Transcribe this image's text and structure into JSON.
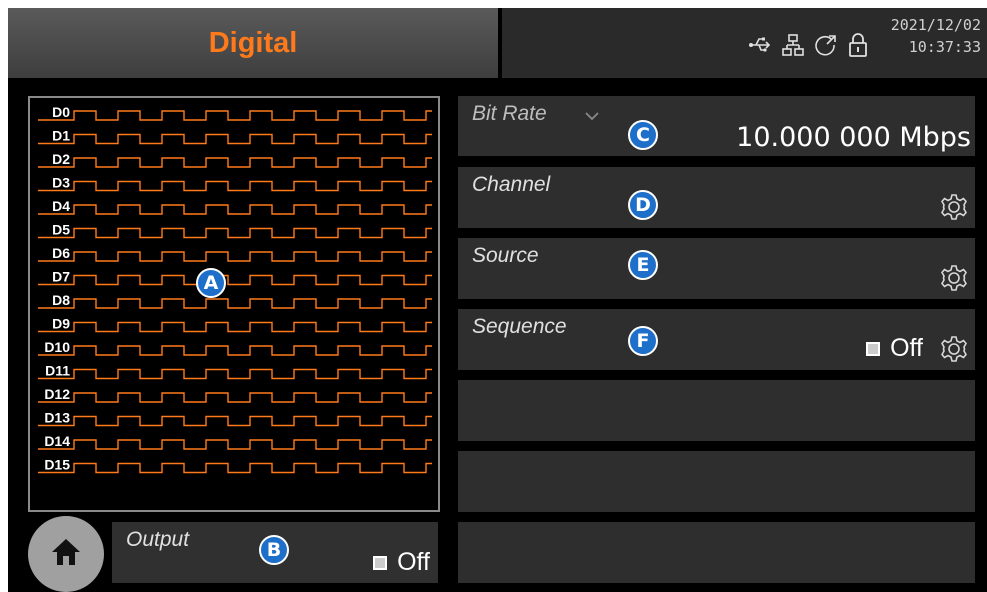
{
  "header": {
    "title": "Digital",
    "date": "2021/12/02",
    "time": "10:37:33",
    "status_icons": [
      "usb-icon",
      "network-icon",
      "sync-icon",
      "lock-icon"
    ]
  },
  "preview": {
    "channels": [
      "D0",
      "D1",
      "D2",
      "D3",
      "D4",
      "D5",
      "D6",
      "D7",
      "D8",
      "D9",
      "D10",
      "D11",
      "D12",
      "D13",
      "D14",
      "D15"
    ],
    "trace_color": "#ff7a1a"
  },
  "output": {
    "label": "Output",
    "state": "Off"
  },
  "params": {
    "bit_rate": {
      "label": "Bit Rate",
      "value": "10.000 000 Mbps"
    },
    "channel": {
      "label": "Channel"
    },
    "source": {
      "label": "Source"
    },
    "sequence": {
      "label": "Sequence",
      "state": "Off"
    }
  },
  "callouts": [
    "A",
    "B",
    "C",
    "D",
    "E",
    "F"
  ],
  "colors": {
    "accent": "#ff7a1a",
    "callout": "#1e6fc9",
    "panel": "#2e2e2e"
  }
}
